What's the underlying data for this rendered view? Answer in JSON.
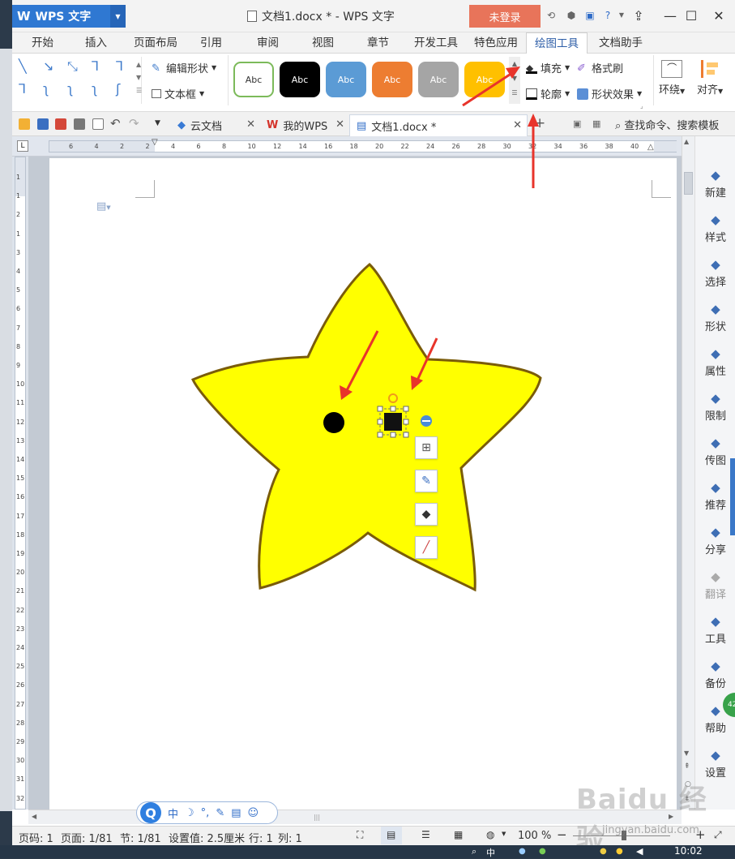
{
  "app": {
    "name": "WPS 文字",
    "window_title": "文档1.docx * - WPS 文字",
    "login_label": "未登录"
  },
  "menus": [
    "开始",
    "插入",
    "页面布局",
    "引用",
    "审阅",
    "视图",
    "章节",
    "开发工具",
    "特色应用",
    "绘图工具",
    "文档助手"
  ],
  "active_menu": "绘图工具",
  "ribbon": {
    "edit_shape": "编辑形状",
    "text_box": "文本框",
    "style_sample": "Abc",
    "style_colors": [
      "#ffffff",
      "#000000",
      "#5b9bd5",
      "#ed7d31",
      "#a5a5a5",
      "#ffc000"
    ],
    "fill": "填充",
    "outline": "轮廓",
    "format_painter": "格式刷",
    "shape_effect": "形状效果",
    "wrap": "环绕",
    "align": "对齐"
  },
  "tabs": [
    {
      "label": "云文档"
    },
    {
      "label": "我的WPS"
    },
    {
      "label": "文档1.docx *"
    }
  ],
  "search_command": "查找命令、搜索模板",
  "ruler": {
    "h_labels": [
      "6",
      "4",
      "2",
      "2",
      "4",
      "6",
      "8",
      "10",
      "12",
      "14",
      "16",
      "18",
      "20",
      "22",
      "24",
      "26",
      "28",
      "30",
      "32",
      "34",
      "36",
      "38",
      "40"
    ],
    "v_labels": [
      "1",
      "1",
      "2",
      "1",
      "3",
      "4",
      "5",
      "6",
      "7",
      "8",
      "9",
      "10",
      "11",
      "12",
      "13",
      "14",
      "15",
      "16",
      "17",
      "18",
      "19",
      "20",
      "21",
      "22",
      "23",
      "24",
      "25",
      "26",
      "27",
      "28",
      "29",
      "30",
      "31",
      "32"
    ]
  },
  "sidebar": [
    {
      "label": "新建",
      "icon": "new-doc-icon"
    },
    {
      "label": "样式",
      "icon": "style-icon"
    },
    {
      "label": "选择",
      "icon": "select-icon"
    },
    {
      "label": "形状",
      "icon": "shape-icon"
    },
    {
      "label": "属性",
      "icon": "property-icon"
    },
    {
      "label": "限制",
      "icon": "restrict-icon"
    },
    {
      "label": "传图",
      "icon": "upload-image-icon"
    },
    {
      "label": "推荐",
      "icon": "recommend-icon"
    },
    {
      "label": "分享",
      "icon": "share-icon"
    },
    {
      "label": "翻译",
      "icon": "translate-icon"
    },
    {
      "label": "工具",
      "icon": "toolbox-icon"
    },
    {
      "label": "备份",
      "icon": "backup-icon"
    },
    {
      "label": "帮助",
      "icon": "help-icon"
    },
    {
      "label": "设置",
      "icon": "settings-icon"
    }
  ],
  "star_colors": {
    "fill": "#ffff00",
    "stroke": "#7a5c0a"
  },
  "float_toolbar": [
    "layout-options-icon",
    "edit-outline-icon",
    "fill-bucket-icon",
    "line-color-icon"
  ],
  "status": {
    "page_num": "页码: 1",
    "page": "页面: 1/81",
    "section": "节: 1/81",
    "setting": "设置值: 2.5厘米",
    "row": "行: 1",
    "col": "列: 1",
    "zoom": "100 %"
  },
  "ime": {
    "lang": "中"
  },
  "clock": "10:02",
  "badge": "42",
  "watermark": {
    "text": "Baidu 经验",
    "url": "jingyan.baidu.com"
  },
  "colors": {
    "accent": "#2f78d2",
    "annotation_arrow": "#e8342b"
  }
}
